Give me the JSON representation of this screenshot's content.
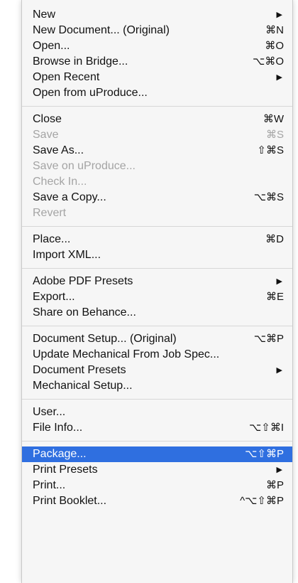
{
  "menu": {
    "groups": [
      {
        "items": [
          {
            "label": "New",
            "submenu": true
          },
          {
            "label": "New Document... (Original)",
            "shortcut": "⌘N"
          },
          {
            "label": "Open...",
            "shortcut": "⌘O"
          },
          {
            "label": "Browse in Bridge...",
            "shortcut": "⌥⌘O"
          },
          {
            "label": "Open Recent",
            "submenu": true
          },
          {
            "label": "Open from uProduce..."
          }
        ]
      },
      {
        "items": [
          {
            "label": "Close",
            "shortcut": "⌘W"
          },
          {
            "label": "Save",
            "shortcut": "⌘S",
            "disabled": true
          },
          {
            "label": "Save As...",
            "shortcut": "⇧⌘S"
          },
          {
            "label": "Save on uProduce...",
            "disabled": true
          },
          {
            "label": "Check In...",
            "disabled": true
          },
          {
            "label": "Save a Copy...",
            "shortcut": "⌥⌘S"
          },
          {
            "label": "Revert",
            "disabled": true
          }
        ]
      },
      {
        "items": [
          {
            "label": "Place...",
            "shortcut": "⌘D"
          },
          {
            "label": "Import XML..."
          }
        ]
      },
      {
        "items": [
          {
            "label": "Adobe PDF Presets",
            "submenu": true
          },
          {
            "label": "Export...",
            "shortcut": "⌘E"
          },
          {
            "label": "Share on Behance..."
          }
        ]
      },
      {
        "items": [
          {
            "label": "Document Setup... (Original)",
            "shortcut": "⌥⌘P"
          },
          {
            "label": "Update Mechanical From Job Spec..."
          },
          {
            "label": "Document Presets",
            "submenu": true
          },
          {
            "label": "Mechanical Setup..."
          }
        ]
      },
      {
        "items": [
          {
            "label": "User..."
          },
          {
            "label": "File Info...",
            "shortcut": "⌥⇧⌘I"
          }
        ]
      },
      {
        "items": [
          {
            "label": "Package...",
            "shortcut": "⌥⇧⌘P",
            "highlighted": true
          },
          {
            "label": "Print Presets",
            "submenu": true
          },
          {
            "label": "Print...",
            "shortcut": "⌘P"
          },
          {
            "label": "Print Booklet...",
            "shortcut": "^⌥⇧⌘P"
          }
        ]
      }
    ],
    "submenu_glyph": "▶",
    "colors": {
      "highlight": "#2f6fe0",
      "disabled_text": "#a4a4a4"
    }
  }
}
